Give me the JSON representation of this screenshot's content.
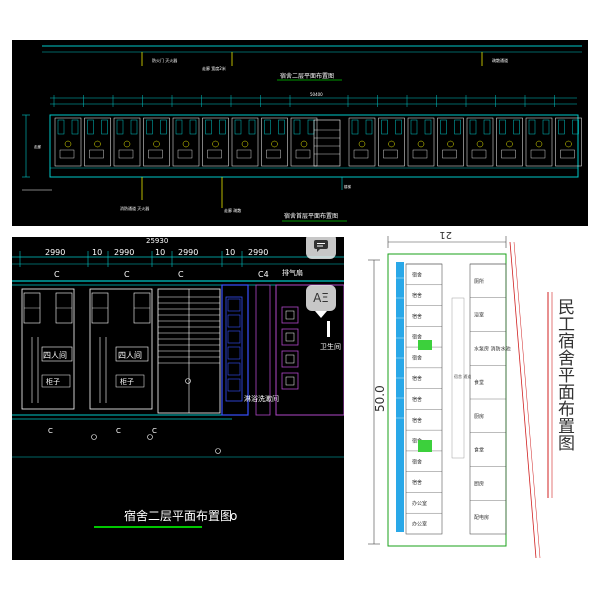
{
  "top_plan": {
    "title_upper": "宿舍二层平面布置图",
    "title_lower": "宿舍首层平面布置图",
    "total_dim": "50400"
  },
  "detail_plan": {
    "dims": [
      "2990",
      "10",
      "2990",
      "10",
      "2990",
      "10",
      "2990"
    ],
    "corner_dim": "25930",
    "col_labels": [
      "C",
      "C",
      "C",
      "C4"
    ],
    "rooms": [
      "四人间",
      "四人间"
    ],
    "cabinets": [
      "柜子",
      "柜子"
    ],
    "air_shaft": "排气扇",
    "wc": "卫生间",
    "washroom": "淋浴洗漱间",
    "title": "宿舍二层平面布置图",
    "title_suffix": "o"
  },
  "site_plan": {
    "title": "民工宿舍平面布置图",
    "width_dim": "21",
    "length_dim": "50.0",
    "labels": [
      "宿舍",
      "宿舍",
      "宿舍",
      "宿舍",
      "宿舍",
      "宿舍",
      "宿舍",
      "宿舍",
      "宿舍",
      "宿舍",
      "宿舍",
      "办公室",
      "办公室"
    ],
    "right_labels": [
      "厕所",
      "浴室",
      "水泵房 消防水池",
      "食堂",
      "厨房",
      "食堂",
      "厨房",
      "配电房"
    ]
  },
  "overlay": {
    "btn_top": "chat-icon",
    "btn_mid": "AΞ",
    "btn_arrow": "triangle-down"
  }
}
